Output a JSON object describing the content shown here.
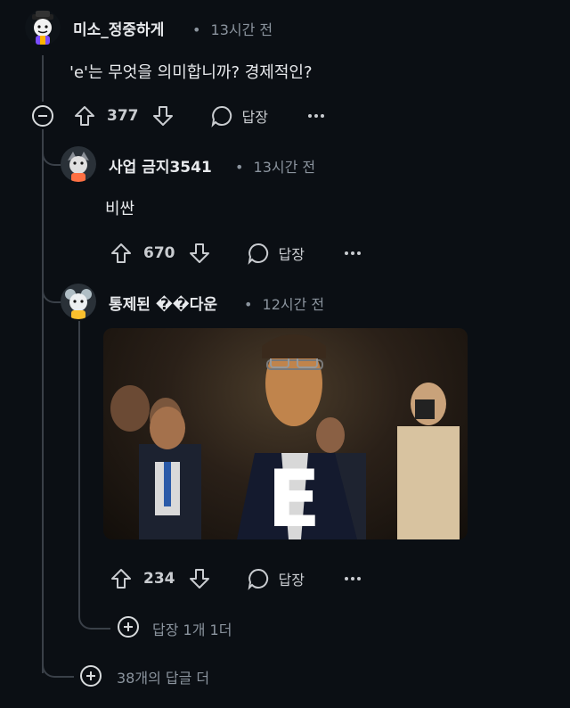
{
  "comments": [
    {
      "username": "미소_정중하게",
      "time": "13시간 전",
      "text": "'e'는 무엇을 의미합니까? 경제적인?",
      "votes": "377",
      "reply_label": "답장"
    },
    {
      "username": "사업 금지3541",
      "time": "13시간 전",
      "text": "비싼",
      "votes": "670",
      "reply_label": "답장"
    },
    {
      "username": "통제된 ��다운",
      "time": "12시간 전",
      "image_letter": "E",
      "votes": "234",
      "reply_label": "답장"
    }
  ],
  "more_replies_nested": "답장 1개 1더",
  "more_replies_top": "38개의 답글 더",
  "meta_dot": "•",
  "colors": {
    "background": "#0b0f14",
    "text": "#d7dadc",
    "muted": "#8b949e",
    "thread_line": "#3a4048"
  }
}
